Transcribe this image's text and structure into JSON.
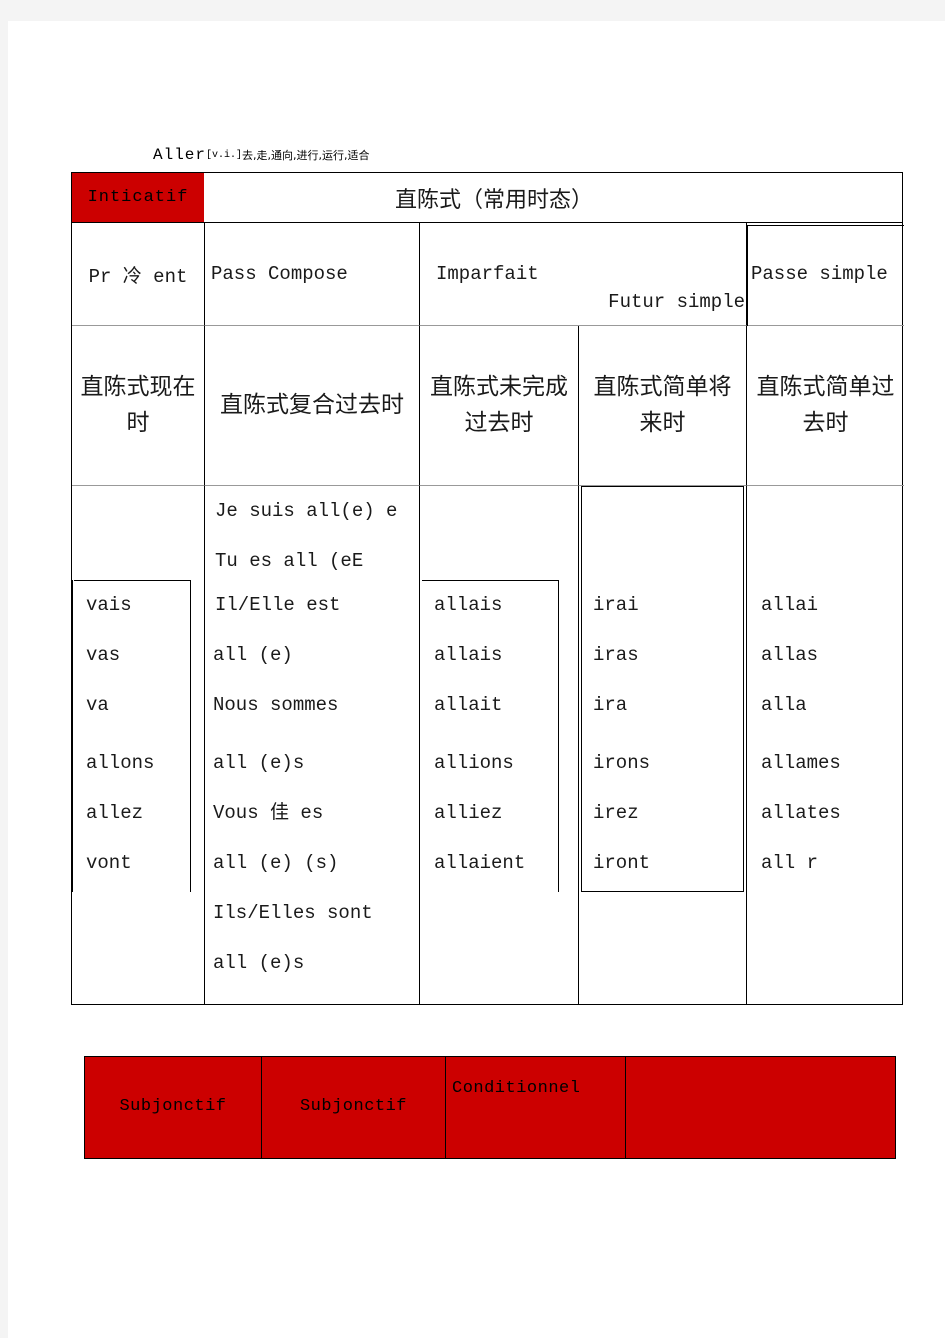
{
  "document": {
    "title": {
      "verb": "Aller",
      "pos": "[v.i.]",
      "gloss": "去,走,通向,进行,运行,适合"
    }
  },
  "main_table": {
    "header": {
      "mood_label": "Inticatif",
      "mood_label_zh": "直陈式（常用时态）",
      "mood_color": "#CC0000"
    },
    "tense_names_fr": {
      "present": "Pr 冷 ent",
      "passe_compose": "Pass Compose",
      "imparfait": "Imparfait",
      "futur_simple": "Futur simple",
      "passe_simple": "Passe simple"
    },
    "tense_names_zh": {
      "present": "直陈式现在时",
      "passe_compose": "直陈式复合过去时",
      "imparfait": "直陈式未完成过去时",
      "futur_simple": "直陈式简单将来时",
      "passe_simple": "直陈式简单过去时"
    },
    "conjugations": {
      "present": [
        "vais",
        "vas",
        "va",
        "allons",
        "allez",
        "vont"
      ],
      "passe_compose_top": [
        "Je suis all(e) e",
        "Tu es all (eE"
      ],
      "passe_compose": [
        "Il/Elle      est",
        "all (e)",
        "Nous sommes",
        "all (e)s",
        "Vous        佳 es",
        "all (e) (s)",
        "Ils/Elles sont",
        "all (e)s"
      ],
      "imparfait": [
        "allais",
        "allais",
        "allait",
        "allions",
        "alliez",
        "allaient"
      ],
      "futur_simple": [
        "irai",
        "iras",
        "ira",
        "irons",
        "irez",
        "iront"
      ],
      "passe_simple": [
        "allai",
        "allas",
        "alla",
        "allames",
        "allates",
        "all r"
      ]
    }
  },
  "bottom_table": {
    "background_color": "#CC0000",
    "cells": [
      "Subjonctif",
      "Subjonctif",
      "Conditionnel",
      ""
    ]
  }
}
